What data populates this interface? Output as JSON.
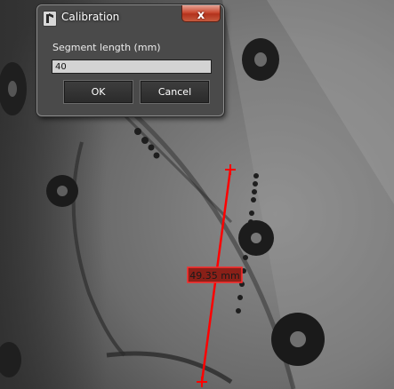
{
  "dialog": {
    "title": "Calibration",
    "close_symbol": "x",
    "field_label": "Segment length (mm)",
    "field_value": "40",
    "ok_label": "OK",
    "cancel_label": "Cancel"
  },
  "measurement": {
    "label": "49.35 mm",
    "line_color": "#ff0000"
  },
  "icons": {
    "app": "app-logo-icon",
    "close": "close-icon"
  }
}
